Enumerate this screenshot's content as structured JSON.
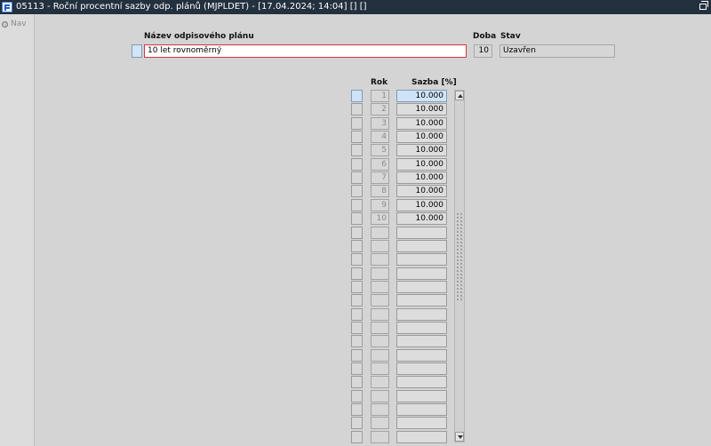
{
  "window": {
    "title": "05113 - Roční procentní sazby odp. plánů (MJPLDET) - [17.04.2024; 14:04]  [] []"
  },
  "nav": {
    "label": "Nav"
  },
  "header": {
    "nazev_label": "Název odpisového plánu",
    "nazev_value": "10 let rovnoměrný",
    "doba_label": "Doba",
    "doba_value": "10",
    "stav_label": "Stav",
    "stav_value": "Uzavřen"
  },
  "grid": {
    "col_rok": "Rok",
    "col_sazba": "Sazba [%]",
    "rows": [
      {
        "rok": "1",
        "sazba": "10.000"
      },
      {
        "rok": "2",
        "sazba": "10.000"
      },
      {
        "rok": "3",
        "sazba": "10.000"
      },
      {
        "rok": "4",
        "sazba": "10.000"
      },
      {
        "rok": "5",
        "sazba": "10.000"
      },
      {
        "rok": "6",
        "sazba": "10.000"
      },
      {
        "rok": "7",
        "sazba": "10.000"
      },
      {
        "rok": "8",
        "sazba": "10.000"
      },
      {
        "rok": "9",
        "sazba": "10.000"
      },
      {
        "rok": "10",
        "sazba": "10.000"
      },
      {
        "rok": "",
        "sazba": ""
      },
      {
        "rok": "",
        "sazba": ""
      },
      {
        "rok": "",
        "sazba": ""
      },
      {
        "rok": "",
        "sazba": ""
      },
      {
        "rok": "",
        "sazba": ""
      },
      {
        "rok": "",
        "sazba": ""
      },
      {
        "rok": "",
        "sazba": ""
      },
      {
        "rok": "",
        "sazba": ""
      },
      {
        "rok": "",
        "sazba": ""
      },
      {
        "rok": "",
        "sazba": ""
      },
      {
        "rok": "",
        "sazba": ""
      },
      {
        "rok": "",
        "sazba": ""
      },
      {
        "rok": "",
        "sazba": ""
      },
      {
        "rok": "",
        "sazba": ""
      },
      {
        "rok": "",
        "sazba": ""
      },
      {
        "rok": "",
        "sazba": ""
      }
    ]
  },
  "colors": {
    "titlebar": "#23303e",
    "active_border": "#d4343b",
    "selection": "#cfe3f6",
    "background": "#d4d4d4"
  },
  "icons": {
    "app": "app-logo-icon",
    "restore": "window-restore-icon",
    "nav": "nav-radio-icon",
    "scroll_up": "arrow-up-icon",
    "scroll_down": "arrow-down-icon"
  }
}
